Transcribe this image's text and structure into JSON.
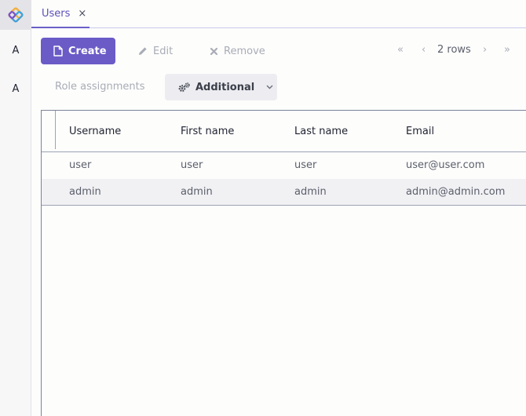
{
  "app": {
    "logo_icon": "app-logo-icon",
    "sidebar_items": [
      {
        "label": "A"
      },
      {
        "label": "A"
      }
    ]
  },
  "tabs": [
    {
      "label": "Users",
      "close": "×"
    }
  ],
  "toolbar": {
    "create_label": "Create",
    "edit_label": "Edit",
    "remove_label": "Remove",
    "role_assignments_label": "Role assignments",
    "additional_label": "Additional"
  },
  "pagination": {
    "first": "«",
    "prev": "‹",
    "rows_label": "2 rows",
    "next": "›",
    "last": "»"
  },
  "table": {
    "columns": [
      "Username",
      "First name",
      "Last name",
      "Email"
    ],
    "rows": [
      {
        "username": "user",
        "first_name": "user",
        "last_name": "user",
        "email": "user@user.com"
      },
      {
        "username": "admin",
        "first_name": "admin",
        "last_name": "admin",
        "email": "admin@admin.com"
      }
    ]
  },
  "colors": {
    "accent": "#6a5bc7",
    "selected_row": "#f1f1f4",
    "disabled_text": "#a9acb6"
  }
}
